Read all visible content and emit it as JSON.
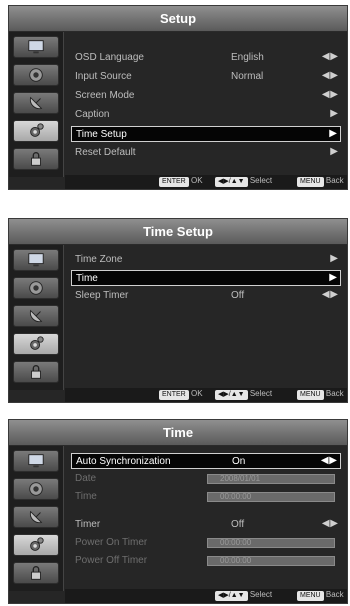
{
  "panel1": {
    "title": "Setup",
    "items": [
      {
        "label": "OSD Language",
        "value": "English",
        "arrow": "◀ ▶"
      },
      {
        "label": "Input Source",
        "value": "Normal",
        "arrow": "◀ ▶"
      },
      {
        "label": "Screen Mode",
        "value": "",
        "arrow": "◀ ▶"
      },
      {
        "label": "Caption",
        "value": "",
        "arrow": "▶"
      },
      {
        "label": "Time Setup",
        "value": "",
        "arrow": "▶"
      },
      {
        "label": "Reset Default",
        "value": "",
        "arrow": "▶"
      }
    ],
    "footer": {
      "enter_key": "ENTER",
      "ok": "OK",
      "nav_key": "◀▶/▲▼",
      "select": "Select",
      "menu_key": "MENU",
      "back": "Back"
    }
  },
  "panel2": {
    "title": "Time Setup",
    "items": [
      {
        "label": "Time Zone",
        "value": "",
        "arrow": "▶"
      },
      {
        "label": "Time",
        "value": "",
        "arrow": "▶"
      },
      {
        "label": "Sleep Timer",
        "value": "Off",
        "arrow": "◀ ▶"
      }
    ],
    "footer": {
      "enter_key": "ENTER",
      "ok": "OK",
      "nav_key": "◀▶/▲▼",
      "select": "Select",
      "menu_key": "MENU",
      "back": "Back"
    }
  },
  "panel3": {
    "title": "Time",
    "items": [
      {
        "label": "Auto Synchronization",
        "value": "On",
        "arrow": "◀ ▶"
      },
      {
        "label": "Date",
        "field": "2008/01/01"
      },
      {
        "label": "Time",
        "field": "00:00:00"
      },
      {
        "label": "Timer",
        "value": "Off",
        "arrow": "◀ ▶"
      },
      {
        "label": "Power On Timer",
        "field": "00:00:00"
      },
      {
        "label": "Power Off Timer",
        "field": "00:00:00"
      }
    ],
    "footer": {
      "nav_key": "◀▶/▲▼",
      "select": "Select",
      "menu_key": "MENU",
      "back": "Back"
    }
  },
  "sidebar_icons": [
    "tv-picture-icon",
    "speaker-sound-icon",
    "satellite-dish-icon",
    "gear-setup-icon",
    "lock-icon"
  ]
}
